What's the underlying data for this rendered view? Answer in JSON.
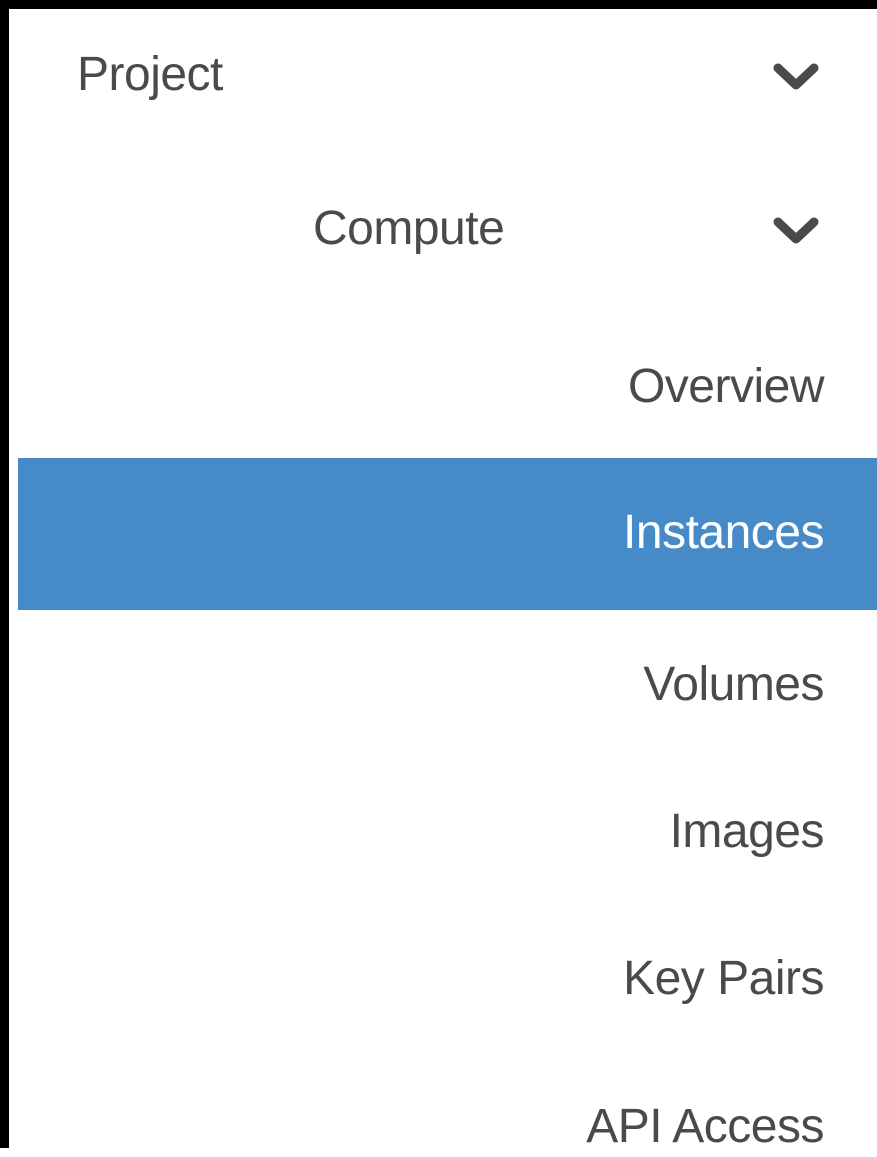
{
  "colors": {
    "active_background": "#468bc8",
    "active_text": "#ffffff",
    "text": "#4a4a4a",
    "border": "#000000"
  },
  "nav": {
    "project": {
      "label": "Project",
      "icon": "chevron-down-icon",
      "expanded": true
    },
    "compute": {
      "label": "Compute",
      "icon": "chevron-down-icon",
      "expanded": true
    },
    "items": [
      {
        "label": "Overview",
        "active": false
      },
      {
        "label": "Instances",
        "active": true
      },
      {
        "label": "Volumes",
        "active": false
      },
      {
        "label": "Images",
        "active": false
      },
      {
        "label": "Key Pairs",
        "active": false
      },
      {
        "label": "API Access",
        "active": false
      }
    ]
  }
}
